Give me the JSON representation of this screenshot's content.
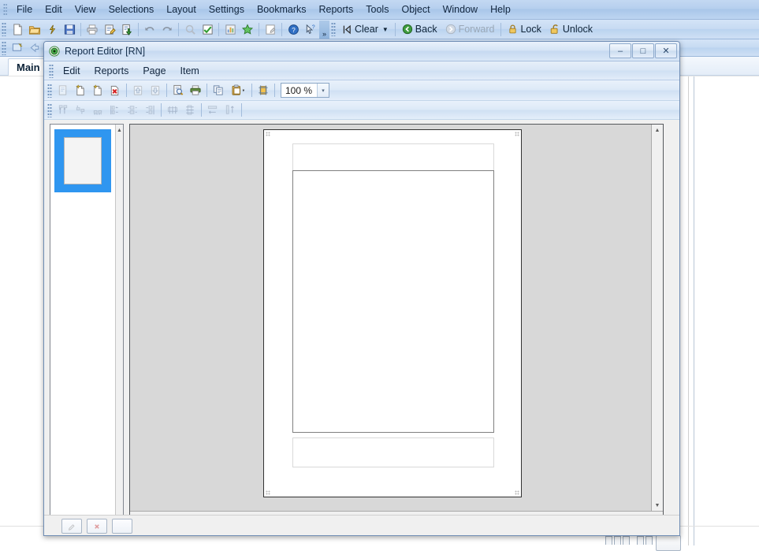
{
  "host": {
    "menu": [
      {
        "label": "File"
      },
      {
        "label": "Edit"
      },
      {
        "label": "View"
      },
      {
        "label": "Selections"
      },
      {
        "label": "Layout"
      },
      {
        "label": "Settings"
      },
      {
        "label": "Bookmarks"
      },
      {
        "label": "Reports"
      },
      {
        "label": "Tools"
      },
      {
        "label": "Object"
      },
      {
        "label": "Window"
      },
      {
        "label": "Help"
      }
    ],
    "toolbar": {
      "icons": [
        {
          "name": "new-document-icon"
        },
        {
          "name": "open-folder-icon"
        },
        {
          "name": "reload-icon"
        },
        {
          "name": "save-icon"
        },
        {
          "name": "print-icon"
        },
        {
          "name": "edit-script-icon"
        },
        {
          "name": "export-icon"
        },
        {
          "name": "undo-icon"
        },
        {
          "name": "redo-icon"
        },
        {
          "name": "search-icon"
        },
        {
          "name": "current-selections-icon"
        },
        {
          "name": "chart-icon"
        },
        {
          "name": "favorite-star-icon"
        },
        {
          "name": "edit-module-icon"
        },
        {
          "name": "help-icon"
        },
        {
          "name": "context-help-icon"
        }
      ],
      "clear_label": "Clear",
      "back_label": "Back",
      "forward_label": "Forward",
      "lock_label": "Lock",
      "unlock_label": "Unlock",
      "overflow_label": "»"
    },
    "tab": {
      "label": "Main"
    }
  },
  "report_editor": {
    "title": "Report Editor [RN]",
    "title_icon": "report-target-icon",
    "window_buttons": {
      "minimize": "–",
      "restore": "□",
      "close": "✕"
    },
    "menu": [
      {
        "label": "Edit"
      },
      {
        "label": "Reports"
      },
      {
        "label": "Page"
      },
      {
        "label": "Item"
      }
    ],
    "toolbar": {
      "icons": [
        {
          "name": "new-report-icon",
          "disabled": true
        },
        {
          "name": "add-page-icon",
          "disabled": false
        },
        {
          "name": "duplicate-page-icon",
          "disabled": false
        },
        {
          "name": "delete-page-icon",
          "disabled": false
        },
        {
          "name": "move-page-up-icon",
          "disabled": true
        },
        {
          "name": "move-page-down-icon",
          "disabled": true
        },
        {
          "name": "print-preview-icon",
          "disabled": false
        },
        {
          "name": "print-icon",
          "disabled": false
        },
        {
          "name": "copy-icon",
          "disabled": false
        },
        {
          "name": "paste-icon",
          "disabled": false
        },
        {
          "name": "page-settings-icon",
          "disabled": false
        }
      ],
      "zoom_value": "100 %",
      "zoom_caret": "▾"
    },
    "toolbar2": {
      "icons": [
        {
          "name": "align-top-icon"
        },
        {
          "name": "align-middle-icon"
        },
        {
          "name": "align-bottom-icon"
        },
        {
          "name": "align-left-icon"
        },
        {
          "name": "align-center-icon"
        },
        {
          "name": "align-right-icon"
        },
        {
          "name": "distribute-horizontal-icon"
        },
        {
          "name": "distribute-vertical-icon"
        },
        {
          "name": "same-width-icon"
        },
        {
          "name": "same-height-icon"
        }
      ]
    },
    "thumbnails": {
      "pages": [
        {
          "name": "page-thumbnail-1",
          "selected": true
        }
      ],
      "scroll_up": "▲",
      "scroll_down": "▼"
    },
    "canvas": {
      "page": {
        "bands": [
          {
            "name": "page-header-band"
          },
          {
            "name": "body-band"
          },
          {
            "name": "page-footer-band"
          }
        ]
      },
      "scroll_up": "▲",
      "scroll_down": "▼",
      "scroll_left": "◀",
      "scroll_right": "▶"
    }
  },
  "colors": {
    "chrome_blue": "#c6d9f1",
    "selection_blue": "#2f96f0",
    "canvas_gray": "#d8d8d8",
    "page_white": "#ffffff",
    "band_border": "#808080"
  }
}
